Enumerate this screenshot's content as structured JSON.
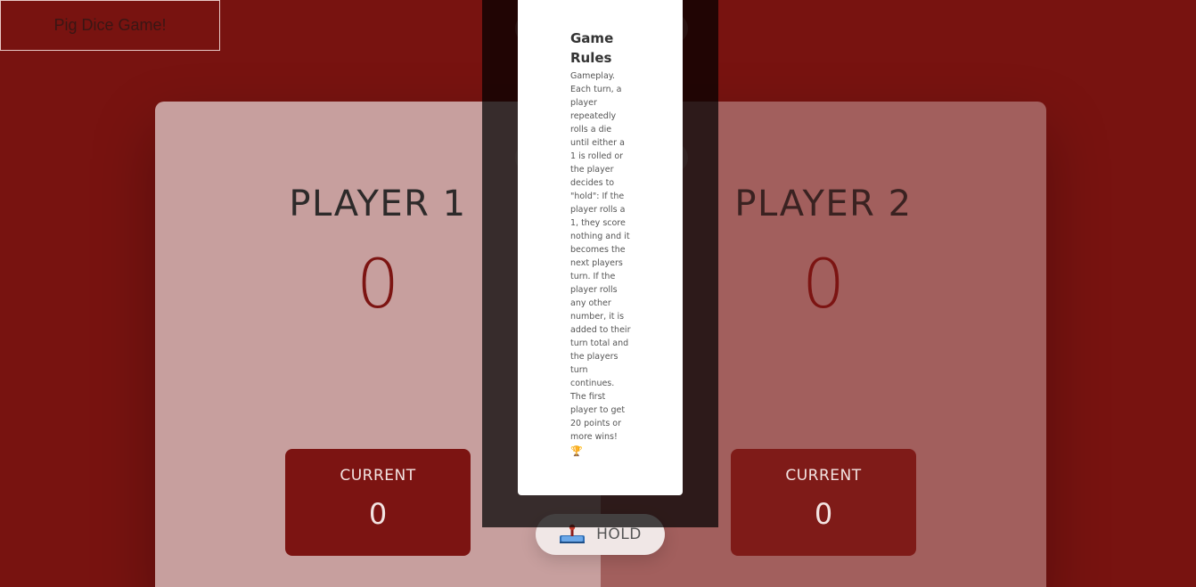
{
  "header": {
    "title": "Pig Dice Game!"
  },
  "players": [
    {
      "name": "PLAYER 1",
      "score": "0",
      "current_label": "CURRENT",
      "current_score": "0"
    },
    {
      "name": "PLAYER 2",
      "score": "0",
      "current_label": "CURRENT",
      "current_score": "0"
    }
  ],
  "controls": {
    "hold_label": "HOLD",
    "hold_icon": "joystick-icon"
  },
  "rules_modal": {
    "title": "Game Rules",
    "body": "Gameplay. Each turn, a player repeatedly rolls a die until either a 1 is rolled or the player decides to \"hold\": If the player rolls a 1, they score nothing and it becomes the next players turn. If the player rolls any other number, it is added to their turn total and the players turn continues. The first player to get 20 points or more wins!",
    "icon": "🏆"
  },
  "colors": {
    "background": "#781310",
    "player_1_panel": "#c79f9e",
    "player_2_panel": "#a25f5d",
    "accent": "#7c1412"
  }
}
